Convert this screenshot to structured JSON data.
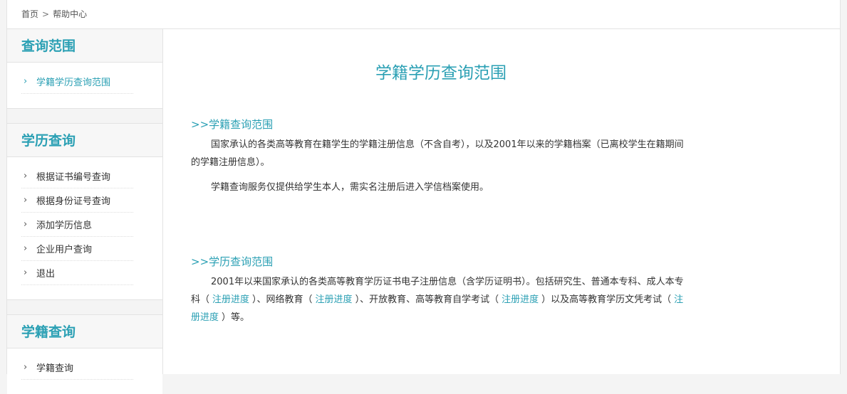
{
  "breadcrumb": {
    "home": "首页",
    "separator": ">",
    "current": "帮助中心"
  },
  "sidebar": {
    "sections": [
      {
        "title": "查询范围",
        "items": [
          {
            "label": "学籍学历查询范围",
            "active": true
          }
        ]
      },
      {
        "title": "学历查询",
        "items": [
          {
            "label": "根据证书编号查询"
          },
          {
            "label": "根据身份证号查询"
          },
          {
            "label": "添加学历信息"
          },
          {
            "label": "企业用户查询"
          },
          {
            "label": "退出"
          }
        ]
      },
      {
        "title": "学籍查询",
        "items": [
          {
            "label": "学籍查询"
          }
        ]
      }
    ],
    "chevron": "›"
  },
  "main": {
    "title": "学籍学历查询范围",
    "section1": {
      "heading": ">>学籍查询范围",
      "p1": "国家承认的各类高等教育在籍学生的学籍注册信息（不含自考），以及2001年以来的学籍档案（已离校学生在籍期间的学籍注册信息）。",
      "p2": "学籍查询服务仅提供给学生本人，需实名注册后进入学信档案使用。"
    },
    "section2": {
      "heading": ">>学历查询范围",
      "text_a": "2001年以来国家承认的各类高等教育学历证书电子注册信息（含学历证明书）。包括研究生、普通本专科、成人本专科（",
      "link1": "注册进度",
      "text_b": "）、网络教育（",
      "link2": "注册进度",
      "text_c": "）、开放教育、高等教育自学考试（",
      "link3": "注册进度",
      "text_d": "）以及高等教育学历文凭考试（",
      "link4": "注册进度",
      "text_e": "）等。"
    }
  },
  "colors": {
    "accent": "#2ba0b4",
    "text": "#333333",
    "border": "#e3e3e3"
  }
}
